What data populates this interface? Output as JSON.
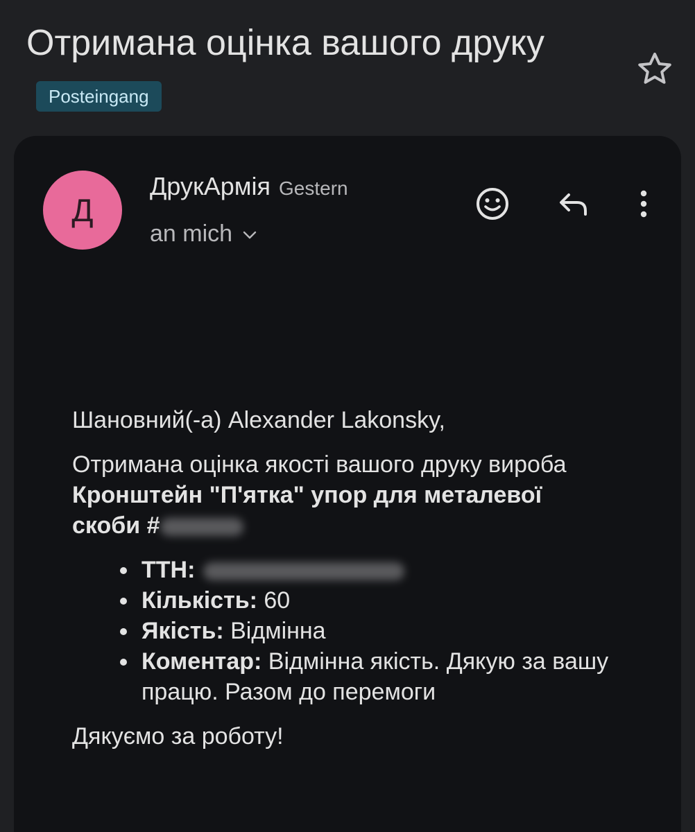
{
  "email": {
    "subject": "Отримана оцінка вашого друку",
    "label": "Posteingang"
  },
  "icons": {
    "star": "star-icon",
    "emoji": "emoji-icon",
    "reply": "reply-icon",
    "more": "more-vert-icon",
    "expand": "chevron-down-icon"
  },
  "sender": {
    "avatar_letter": "Д",
    "avatar_color": "#e86a9a",
    "name": "ДрукАрмія",
    "date": "Gestern",
    "recipient": "an mich"
  },
  "message": {
    "greeting": "Шановний(-а) Alexander Lakonsky,",
    "intro_text": "Отримана оцінка якості вашого друку вироба ",
    "product_name": "Кронштейн \"П'ятка\" упор для металевої скоби #",
    "details": [
      {
        "label": "ТТН:",
        "value": ""
      },
      {
        "label": "Кількість:",
        "value": " 60"
      },
      {
        "label": "Якість:",
        "value": " Відмінна"
      },
      {
        "label": "Коментар:",
        "value": " Відмінна якість. Дякую за вашу працю. Разом до перемоги"
      }
    ],
    "closing": "Дякуємо за роботу!"
  },
  "colors": {
    "background": "#1f2023",
    "card": "#111215",
    "label_badge": "#1c4a5a"
  }
}
